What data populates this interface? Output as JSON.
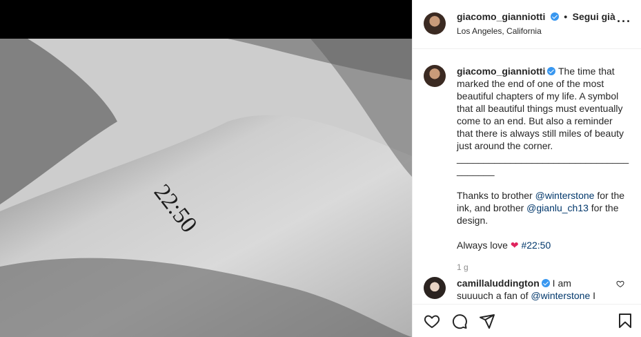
{
  "post": {
    "username": "giacomo_gianniotti",
    "follow_status": "Segui già",
    "separator": "•",
    "location": "Los Angeles, California",
    "tattoo_text": "22:50"
  },
  "caption": {
    "username": "giacomo_gianniotti",
    "text1": "The time that marked the end of one of the most beautiful chapters of my life. A symbol that all beautiful things must eventually come to an end. But also a reminder that there is always still miles of beauty just around the corner.",
    "divider": "_______________________________________",
    "thanks_pre": "Thanks to brother ",
    "mention1": "@winterstone",
    "thanks_mid": " for the ink, and brother ",
    "mention2": "@gianlu_ch13",
    "thanks_post": " for the design.",
    "always": "Always love ",
    "hashtag": "#22:50",
    "time": "1 g"
  },
  "comment": {
    "username": "camillaluddington",
    "text_pre": "I am suuuuch a fan of ",
    "mention": "@winterstone",
    "text_post": " I"
  },
  "icons": {
    "like": "heart-icon",
    "comment": "comment-icon",
    "share": "share-icon",
    "save": "bookmark-icon",
    "more": "more-options-icon"
  },
  "colors": {
    "verified": "#3897f0",
    "link": "#00376b",
    "heart": "#e0245e"
  }
}
